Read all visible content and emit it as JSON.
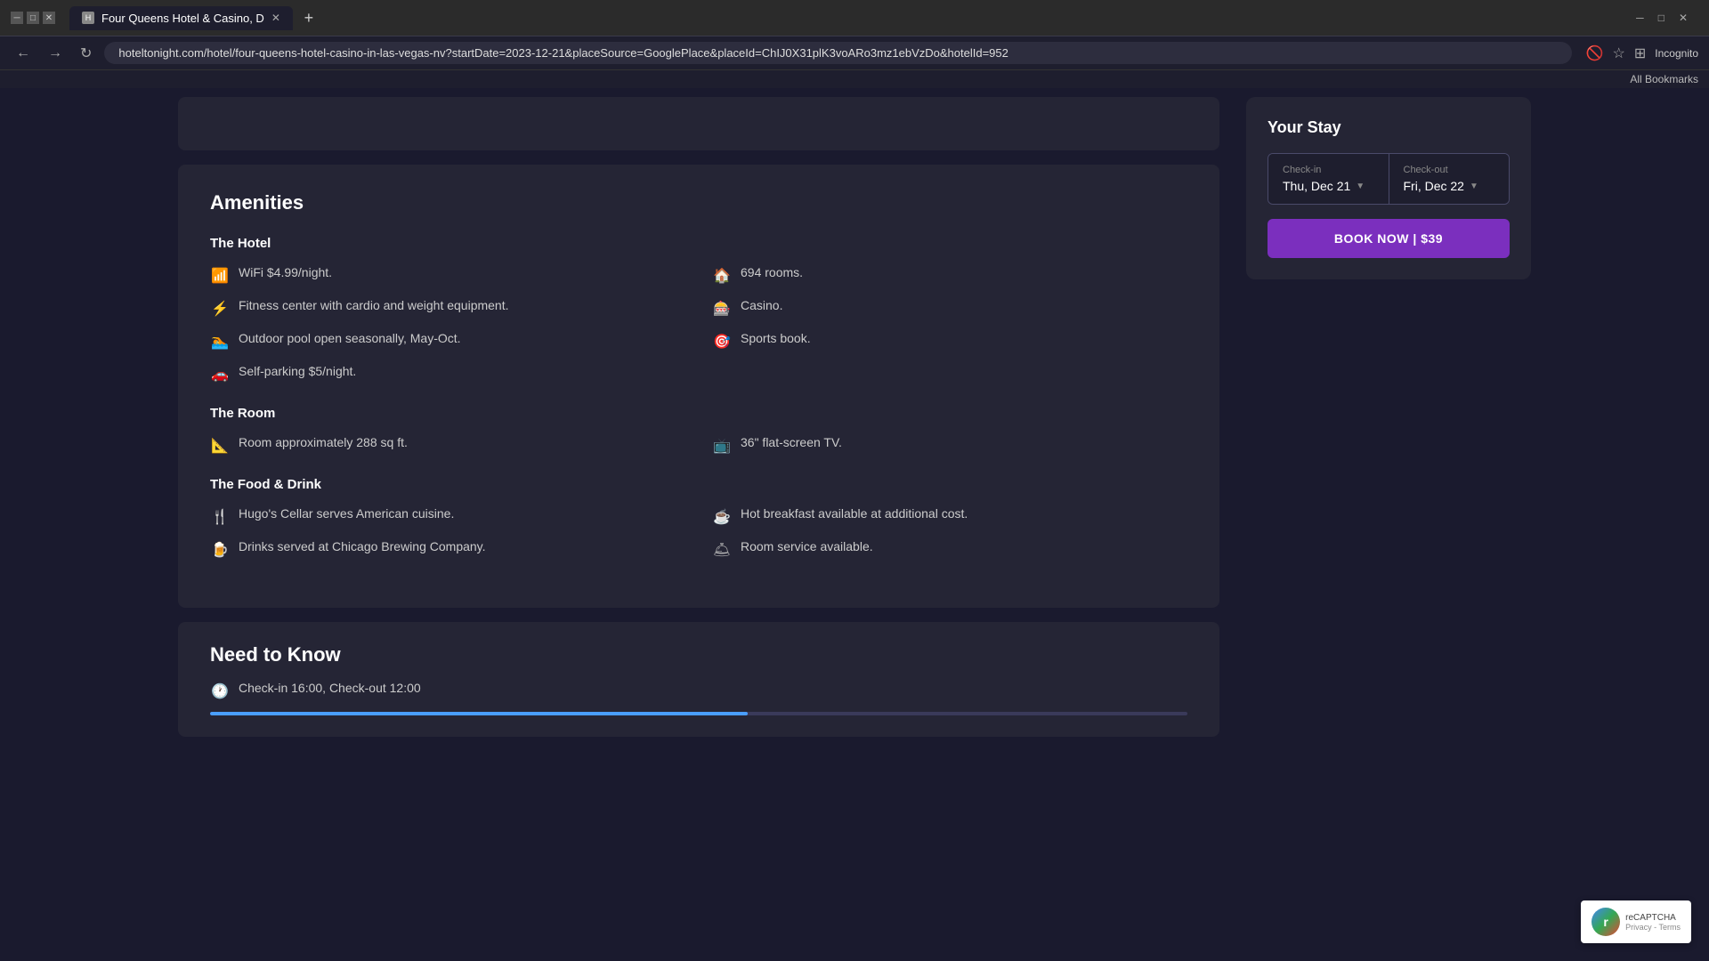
{
  "browser": {
    "tab_label": "Four Queens Hotel & Casino, D",
    "url": "hoteltonight.com/hotel/four-queens-hotel-casino-in-las-vegas-nv?startDate=2023-12-21&placeSource=GooglePlace&placeId=ChIJ0X31plK3voARo3mz1ebVzDo&hotelId=952",
    "new_tab_label": "+",
    "back_btn": "←",
    "forward_btn": "→",
    "refresh_btn": "↻",
    "incognito_label": "Incognito",
    "bookmarks_label": "All Bookmarks"
  },
  "amenities": {
    "title": "Amenities",
    "hotel_section": "The Hotel",
    "hotel_items": [
      {
        "icon": "wifi",
        "text": "WiFi $4.99/night."
      },
      {
        "icon": "fitness",
        "text": "Fitness center with cardio and weight equipment."
      },
      {
        "icon": "pool",
        "text": "Outdoor pool open seasonally, May-Oct."
      },
      {
        "icon": "parking",
        "text": "Self-parking $5/night."
      },
      {
        "icon": "rooms",
        "text": "694 rooms."
      },
      {
        "icon": "casino",
        "text": "Casino."
      },
      {
        "icon": "sports",
        "text": "Sports book."
      }
    ],
    "room_section": "The Room",
    "room_items": [
      {
        "icon": "room-size",
        "text": "Room approximately 288 sq ft."
      },
      {
        "icon": "tv",
        "text": "36\" flat-screen TV."
      }
    ],
    "food_section": "The Food & Drink",
    "food_items": [
      {
        "icon": "restaurant",
        "text": "Hugo's Cellar serves American cuisine."
      },
      {
        "icon": "drinks",
        "text": "Drinks served at Chicago Brewing Company."
      },
      {
        "icon": "breakfast",
        "text": "Hot breakfast available at additional cost."
      },
      {
        "icon": "room-service",
        "text": "Room service available."
      }
    ]
  },
  "need_to_know": {
    "title": "Need to Know",
    "checkin_text": "Check-in 16:00, Check-out 12:00"
  },
  "your_stay": {
    "title": "Your Stay",
    "checkin_label": "Check-in",
    "checkin_value": "Thu, Dec 21",
    "checkout_label": "Check-out",
    "checkout_value": "Fri, Dec 22",
    "book_now_label": "BOOK NOW | $39"
  },
  "recaptcha": {
    "label": "reCAPTCHA",
    "links": "Privacy - Terms"
  },
  "privacy_label": "Privacy -"
}
